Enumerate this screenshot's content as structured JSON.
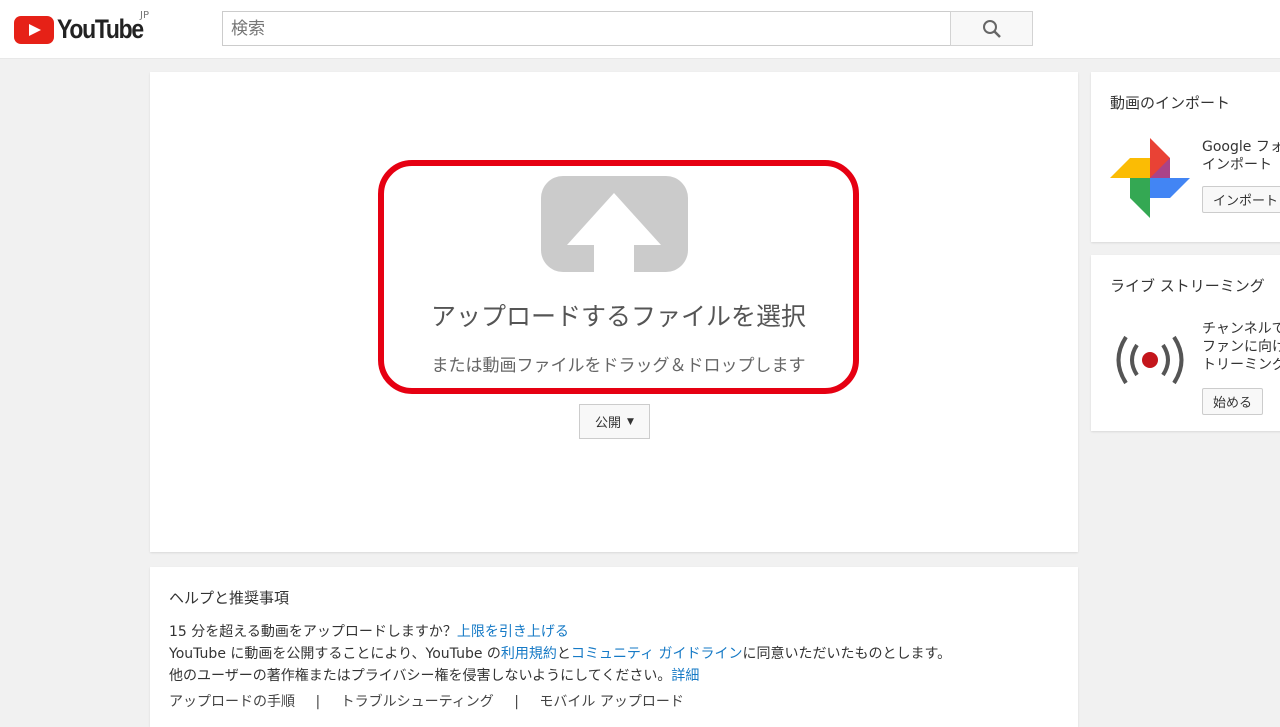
{
  "header": {
    "logo_text": "YouTube",
    "logo_region": "JP",
    "search_placeholder": "検索",
    "search_icon": "search-icon"
  },
  "upload": {
    "title": "アップロードするファイルを選択",
    "subtitle": "または動画ファイルをドラッグ＆ドロップします",
    "privacy_label": "公開",
    "highlight_color": "#e60012"
  },
  "help": {
    "title": "ヘルプと推奨事項",
    "line1_text": "15 分を超える動画をアップロードしますか？",
    "line1_link": "上限を引き上げる",
    "line2_a": "YouTube に動画を公開することにより、YouTube の",
    "line2_link1": "利用規約",
    "line2_b": "と",
    "line2_link2": "コミュニティ ガイドライン",
    "line2_c": "に同意いただいたものとします。",
    "line3_text": "他のユーザーの著作権またはプライバシー権を侵害しないようにしてください。",
    "line3_link": "詳細",
    "links": [
      "アップロードの手順",
      "トラブルシューティング",
      "モバイル アップロード"
    ],
    "separator": "|"
  },
  "sidebar": {
    "import": {
      "title": "動画のインポート",
      "line1": "Google フォ",
      "line2": "インポート",
      "button": "インポート"
    },
    "live": {
      "title": "ライブ ストリーミング",
      "lines": [
        "チャンネルで",
        "ファンに向け",
        "トリーミング"
      ],
      "button": "始める"
    }
  }
}
